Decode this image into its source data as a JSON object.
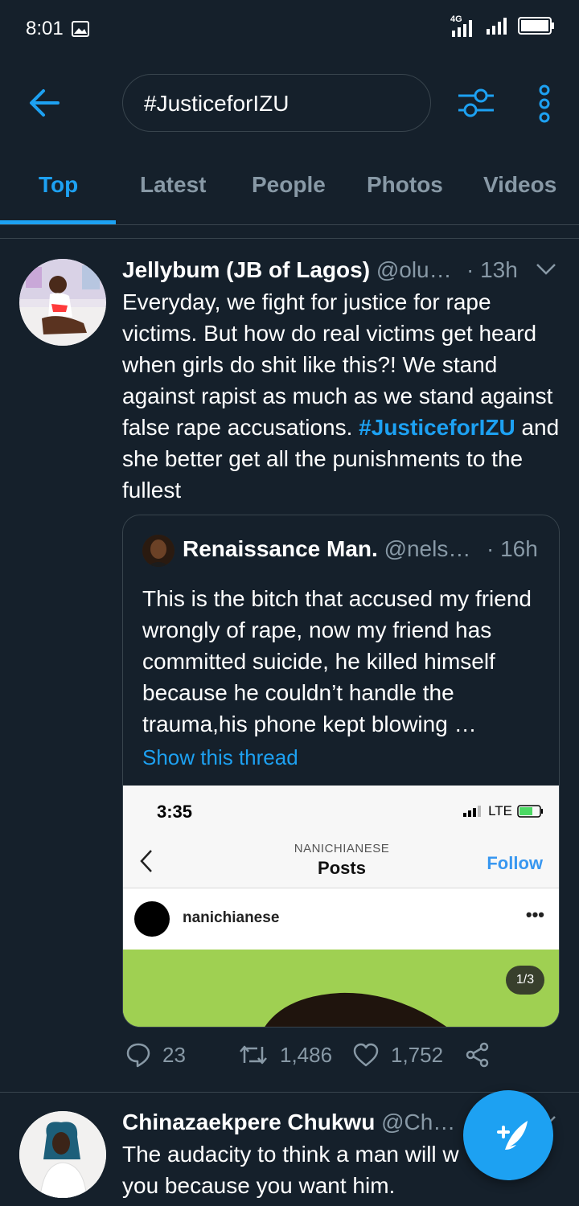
{
  "status_bar": {
    "time": "8:01",
    "network": "4G"
  },
  "search": {
    "query": "#JusticeforIZU"
  },
  "tabs": [
    {
      "label": "Top",
      "active": true
    },
    {
      "label": "Latest",
      "active": false
    },
    {
      "label": "People",
      "active": false
    },
    {
      "label": "Photos",
      "active": false
    },
    {
      "label": "Videos",
      "active": false
    }
  ],
  "tweet1": {
    "name": "Jellybum (JB of Lagos)",
    "handle": "@olu…",
    "time": "· 13h",
    "text_before": "Everyday, we fight for justice for rape victims. But how do real victims get heard when girls do shit like this?! We stand against rapist as much as we stand against false rape accusations.",
    "hashtag": "#JusticeforIZU",
    "text_after": "and she better get all the punishments to the fullest",
    "quote": {
      "name": "Renaissance Man.",
      "handle": "@nels…",
      "time": "· 16h",
      "text": "This is the bitch that accused my friend wrongly of rape, now my friend has committed suicide, he killed himself because he couldn’t handle the trauma,his phone kept blowing …",
      "show_thread": "Show this thread",
      "screenshot": {
        "time": "3:35",
        "network": "LTE",
        "account": "NANICHIANESE",
        "title": "Posts",
        "follow": "Follow",
        "username": "nanichianese",
        "more": "•••",
        "page": "1/3"
      }
    },
    "replies": "23",
    "retweets": "1,486",
    "likes": "1,752"
  },
  "tweet2": {
    "name": "Chinazaekpere Chukwu",
    "handle": "@Ch…",
    "text": "The audacity to think a man will w you because you want him."
  },
  "colors": {
    "background": "#15202b",
    "accent": "#1da1f2",
    "secondary_text": "#8899a6",
    "border": "#38444d"
  }
}
